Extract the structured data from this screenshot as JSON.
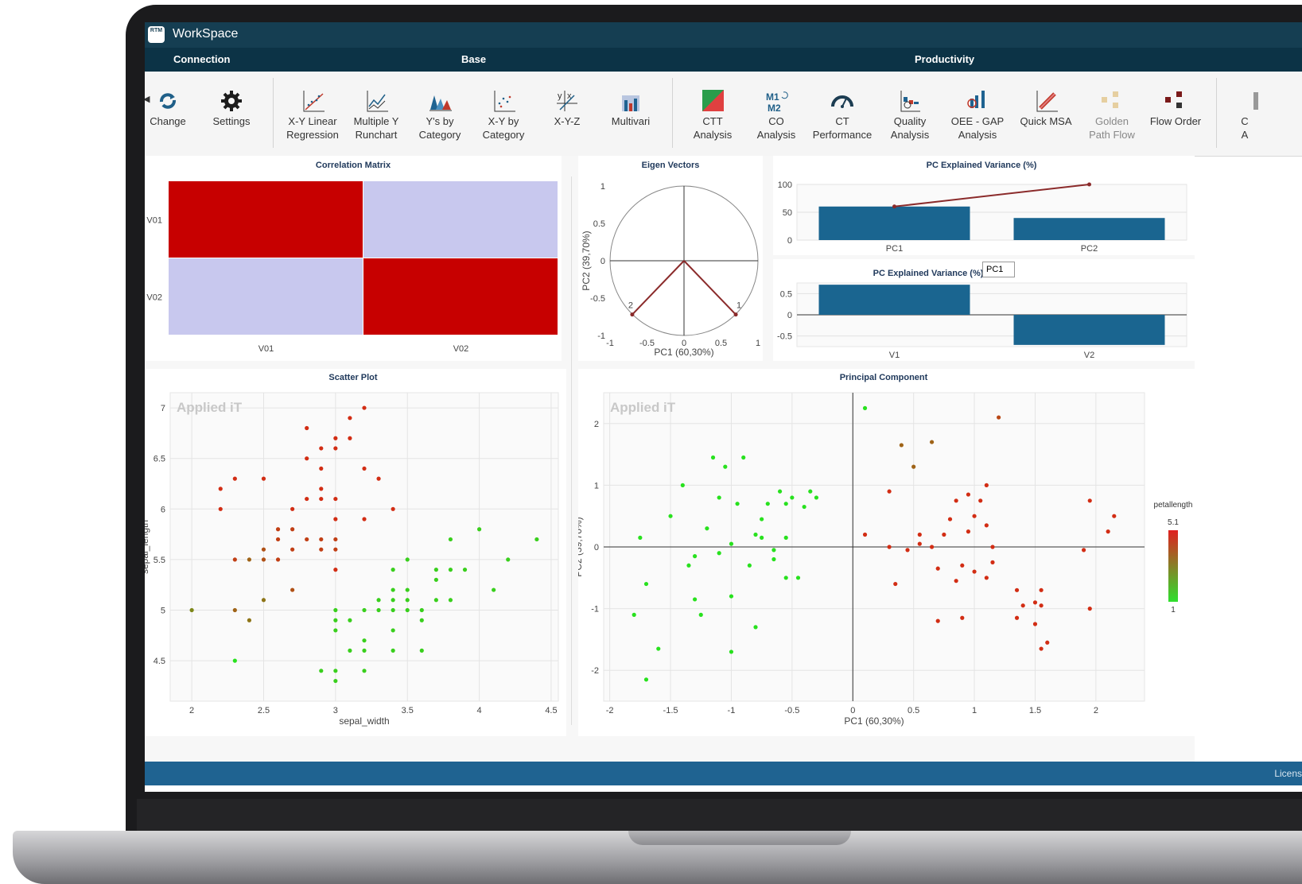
{
  "app": {
    "title": "WorkSpace",
    "logo_text": "RTM"
  },
  "groups": [
    "Connection",
    "Base",
    "Productivity"
  ],
  "toolbar": {
    "items": [
      {
        "label": "Change",
        "icon": "change-icon"
      },
      {
        "label": "Settings",
        "icon": "gear-icon"
      },
      {
        "label": "X-Y Linear\nRegression",
        "icon": "linear-regression-icon"
      },
      {
        "label": "Multiple Y\nRunchart",
        "icon": "runchart-icon"
      },
      {
        "label": "Y's by\nCategory",
        "icon": "ys-by-category-icon"
      },
      {
        "label": "X-Y by\nCategory",
        "icon": "xy-by-category-icon"
      },
      {
        "label": "X-Y-Z",
        "icon": "xyz-icon"
      },
      {
        "label": "Multivari",
        "icon": "multivari-icon"
      },
      {
        "label": "CTT\nAnalysis",
        "icon": "ctt-analysis-icon"
      },
      {
        "label": "CO\nAnalysis",
        "icon": "co-analysis-icon"
      },
      {
        "label": "CT\nPerformance",
        "icon": "gauge-icon"
      },
      {
        "label": "Quality\nAnalysis",
        "icon": "quality-analysis-icon"
      },
      {
        "label": "OEE - GAP\nAnalysis",
        "icon": "oee-gap-icon"
      },
      {
        "label": "Quick MSA",
        "icon": "quick-msa-icon"
      },
      {
        "label": "Golden\nPath Flow",
        "icon": "golden-path-icon"
      },
      {
        "label": "Flow Order",
        "icon": "flow-order-icon"
      },
      {
        "label": "C\nA",
        "icon": "truncated-icon"
      }
    ]
  },
  "status": {
    "text": "Licens"
  },
  "colors": {
    "titlebar": "#153e52",
    "ribbon_header": "#0c3346",
    "status": "#1f6391",
    "bar": "#1a6590",
    "arrow": "#8b2b2b"
  },
  "panels": {
    "correlation_title": "Correlation Matrix",
    "eigen_title": "Eigen Vectors",
    "variance_title": "PC Explained Variance (%)",
    "loadings_title": "PC Explained Variance (%)",
    "loadings_select": "PC1",
    "scatter_title": "Scatter Plot",
    "pc_title": "Principal Component",
    "watermark": "Applied iT"
  },
  "chart_data": [
    {
      "type": "heatmap",
      "title": "Correlation Matrix",
      "x": [
        "V01",
        "V02"
      ],
      "y": [
        "V01",
        "V02"
      ],
      "cells": [
        [
          "high",
          "low"
        ],
        [
          "low",
          "high"
        ]
      ],
      "colors": {
        "high": "#c70000",
        "low": "#c8c8ee"
      }
    },
    {
      "type": "scatter",
      "title": "Eigen Vectors",
      "xlabel": "PC1 (60,30%)",
      "ylabel": "PC2 (39,70%)",
      "xlim": [
        -1,
        1
      ],
      "ylim": [
        -1,
        1
      ],
      "xticks": [
        "-1",
        "-0.5",
        "0",
        "0.5",
        "1"
      ],
      "yticks": [
        "-1",
        "-0.5",
        "0",
        "0.5",
        "1"
      ],
      "vectors": [
        {
          "name": "1",
          "x": 0.7,
          "y": -0.72
        },
        {
          "name": "2",
          "x": -0.7,
          "y": -0.72
        }
      ]
    },
    {
      "type": "bar",
      "title": "PC Explained Variance (%)",
      "categories": [
        "PC1",
        "PC2"
      ],
      "values": [
        60.3,
        39.7
      ],
      "cumulative": [
        60.3,
        100
      ],
      "ylim": [
        0,
        100
      ],
      "yticks": [
        "0",
        "50",
        "100"
      ]
    },
    {
      "type": "bar",
      "title": "PC Explained Variance (%)",
      "categories": [
        "V1",
        "V2"
      ],
      "values": [
        0.71,
        -0.71
      ],
      "ylim": [
        -0.75,
        0.75
      ],
      "yticks": [
        "-0.5",
        "0",
        "0.5"
      ]
    },
    {
      "type": "scatter",
      "title": "Scatter Plot",
      "xlabel": "sepal_width",
      "ylabel": "sepal_length",
      "xlim": [
        1.85,
        4.55
      ],
      "ylim": [
        4.1,
        7.15
      ],
      "xticks": [
        "2",
        "2.5",
        "3",
        "3.5",
        "4",
        "4.5"
      ],
      "yticks": [
        "4.5",
        "5",
        "5.5",
        "6",
        "6.5",
        "7"
      ],
      "color_scale": {
        "name": "petallength",
        "min": "1",
        "max": "5.1"
      },
      "points": [
        [
          2.0,
          5.0,
          0.5
        ],
        [
          2.2,
          6.2,
          1
        ],
        [
          2.2,
          6.0,
          1
        ],
        [
          2.3,
          6.3,
          1
        ],
        [
          2.3,
          5.5,
          0.9
        ],
        [
          2.3,
          5.0,
          0.7
        ],
        [
          2.3,
          4.5,
          0
        ],
        [
          2.4,
          5.5,
          0.7
        ],
        [
          2.4,
          4.9,
          0.6
        ],
        [
          2.5,
          6.3,
          1
        ],
        [
          2.5,
          5.6,
          0.8
        ],
        [
          2.5,
          5.5,
          0.8
        ],
        [
          2.5,
          5.1,
          0.6
        ],
        [
          2.6,
          5.8,
          0.9
        ],
        [
          2.6,
          5.7,
          0.9
        ],
        [
          2.6,
          5.5,
          0.9
        ],
        [
          2.7,
          5.8,
          0.9
        ],
        [
          2.7,
          5.6,
          0.9
        ],
        [
          2.7,
          5.2,
          0.8
        ],
        [
          2.7,
          6.0,
          1
        ],
        [
          2.8,
          6.8,
          1
        ],
        [
          2.8,
          6.5,
          1
        ],
        [
          2.8,
          6.1,
          1
        ],
        [
          2.8,
          5.7,
          0.9
        ],
        [
          2.9,
          6.6,
          1
        ],
        [
          2.9,
          6.4,
          1
        ],
        [
          2.9,
          6.2,
          1
        ],
        [
          2.9,
          6.1,
          1
        ],
        [
          2.9,
          5.7,
          0.9
        ],
        [
          2.9,
          5.6,
          0.9
        ],
        [
          2.9,
          4.4,
          0.1
        ],
        [
          3.0,
          6.7,
          1
        ],
        [
          3.0,
          6.6,
          1
        ],
        [
          3.0,
          6.1,
          1
        ],
        [
          3.0,
          5.9,
          1
        ],
        [
          3.0,
          5.7,
          0.9
        ],
        [
          3.0,
          5.6,
          0.9
        ],
        [
          3.0,
          5.4,
          1
        ],
        [
          3.0,
          5.0,
          0.1
        ],
        [
          3.0,
          4.9,
          0.1
        ],
        [
          3.0,
          4.8,
          0.1
        ],
        [
          3.0,
          4.4,
          0.1
        ],
        [
          3.0,
          4.3,
          0.1
        ],
        [
          3.1,
          6.9,
          1
        ],
        [
          3.1,
          6.7,
          1
        ],
        [
          3.1,
          4.9,
          0.1
        ],
        [
          3.1,
          4.6,
          0.1
        ],
        [
          3.2,
          7.0,
          1
        ],
        [
          3.2,
          6.4,
          1
        ],
        [
          3.2,
          5.9,
          1
        ],
        [
          3.2,
          5.0,
          0.1
        ],
        [
          3.2,
          4.7,
          0.1
        ],
        [
          3.2,
          4.6,
          0.1
        ],
        [
          3.2,
          4.4,
          0.1
        ],
        [
          3.3,
          6.3,
          1
        ],
        [
          3.3,
          5.1,
          0.1
        ],
        [
          3.3,
          5.0,
          0.1
        ],
        [
          3.4,
          6.0,
          1
        ],
        [
          3.4,
          5.4,
          0.1
        ],
        [
          3.4,
          5.2,
          0.1
        ],
        [
          3.4,
          5.1,
          0.1
        ],
        [
          3.4,
          5.0,
          0.1
        ],
        [
          3.4,
          4.8,
          0.1
        ],
        [
          3.4,
          4.6,
          0.1
        ],
        [
          3.5,
          5.5,
          0.1
        ],
        [
          3.5,
          5.2,
          0.1
        ],
        [
          3.5,
          5.1,
          0.1
        ],
        [
          3.5,
          5.0,
          0.1
        ],
        [
          3.6,
          5.0,
          0.1
        ],
        [
          3.6,
          4.9,
          0.1
        ],
        [
          3.6,
          4.6,
          0.1
        ],
        [
          3.7,
          5.4,
          0.1
        ],
        [
          3.7,
          5.3,
          0.1
        ],
        [
          3.7,
          5.1,
          0.1
        ],
        [
          3.8,
          5.7,
          0.1
        ],
        [
          3.8,
          5.4,
          0.1
        ],
        [
          3.8,
          5.1,
          0.1
        ],
        [
          3.9,
          5.4,
          0.1
        ],
        [
          4.0,
          5.8,
          0.1
        ],
        [
          4.1,
          5.2,
          0.1
        ],
        [
          4.2,
          5.5,
          0.1
        ],
        [
          4.4,
          5.7,
          0.1
        ]
      ]
    },
    {
      "type": "scatter",
      "title": "Principal Component",
      "xlabel": "PC1 (60,30%)",
      "ylabel": "PC2 (39,70%)",
      "xlim": [
        -2.05,
        2.4
      ],
      "ylim": [
        -2.5,
        2.5
      ],
      "xticks": [
        "-2",
        "-1.5",
        "-1",
        "-0.5",
        "0",
        "0.5",
        "1",
        "1.5",
        "2"
      ],
      "yticks": [
        "-2",
        "-1",
        "0",
        "1",
        "2"
      ],
      "points": [
        [
          0.1,
          2.25,
          0
        ],
        [
          -1.7,
          -0.6,
          0
        ],
        [
          -1.6,
          -1.65,
          0
        ],
        [
          -1.5,
          0.5,
          0
        ],
        [
          -1.4,
          1.0,
          0
        ],
        [
          -1.3,
          -0.15,
          0
        ],
        [
          -1.3,
          -0.85,
          0
        ],
        [
          -1.2,
          0.3,
          0
        ],
        [
          -1.15,
          1.45,
          0
        ],
        [
          -1.1,
          0.8,
          0
        ],
        [
          -1.05,
          1.3,
          0
        ],
        [
          -1.0,
          0.05,
          0
        ],
        [
          -1.0,
          -0.8,
          0
        ],
        [
          -0.95,
          0.7,
          0
        ],
        [
          -0.9,
          1.45,
          0
        ],
        [
          -0.8,
          0.2,
          0
        ],
        [
          -0.75,
          0.15,
          0
        ],
        [
          -0.7,
          0.7,
          0
        ],
        [
          -0.65,
          -0.2,
          0
        ],
        [
          -0.6,
          0.9,
          0
        ],
        [
          -0.55,
          0.7,
          0
        ],
        [
          -0.55,
          -0.5,
          0
        ],
        [
          -0.5,
          0.8,
          0
        ],
        [
          -0.8,
          -1.3,
          0
        ],
        [
          -1.0,
          -1.7,
          0
        ],
        [
          -1.8,
          -1.1,
          0
        ],
        [
          -1.7,
          -2.15,
          0
        ],
        [
          -1.75,
          0.15,
          0
        ],
        [
          -1.35,
          -0.3,
          0
        ],
        [
          -1.25,
          -1.1,
          0
        ],
        [
          -1.1,
          -0.1,
          0
        ],
        [
          -0.85,
          -0.3,
          0
        ],
        [
          -0.75,
          0.45,
          0
        ],
        [
          -0.65,
          -0.05,
          0
        ],
        [
          -0.55,
          0.15,
          0
        ],
        [
          -0.45,
          -0.5,
          0
        ],
        [
          -0.4,
          0.65,
          0
        ],
        [
          -0.35,
          0.9,
          0
        ],
        [
          -0.3,
          0.8,
          0
        ],
        [
          0.4,
          1.65,
          0.7
        ],
        [
          0.5,
          1.3,
          0.7
        ],
        [
          0.65,
          1.7,
          0.7
        ],
        [
          0.3,
          0.9,
          1
        ],
        [
          0.1,
          0.2,
          1
        ],
        [
          0.3,
          0.0,
          1
        ],
        [
          0.35,
          -0.6,
          1
        ],
        [
          0.45,
          -0.05,
          1
        ],
        [
          0.55,
          0.05,
          1
        ],
        [
          0.55,
          0.2,
          1
        ],
        [
          0.65,
          0.0,
          1
        ],
        [
          0.7,
          -0.35,
          1
        ],
        [
          0.7,
          -1.2,
          1
        ],
        [
          0.75,
          0.2,
          1
        ],
        [
          0.8,
          0.45,
          1
        ],
        [
          0.85,
          0.75,
          1
        ],
        [
          0.85,
          -0.55,
          1
        ],
        [
          0.9,
          -1.15,
          1
        ],
        [
          0.9,
          -0.3,
          1
        ],
        [
          0.95,
          0.85,
          1
        ],
        [
          0.95,
          0.25,
          1
        ],
        [
          1.0,
          0.5,
          1
        ],
        [
          1.0,
          -0.4,
          1
        ],
        [
          1.05,
          0.75,
          1
        ],
        [
          1.1,
          1.0,
          1
        ],
        [
          1.1,
          0.35,
          1
        ],
        [
          1.1,
          -0.5,
          1
        ],
        [
          1.15,
          -0.25,
          1
        ],
        [
          1.15,
          0.0,
          1
        ],
        [
          1.2,
          2.1,
          0.85
        ],
        [
          1.35,
          -0.7,
          1
        ],
        [
          1.35,
          -1.15,
          1
        ],
        [
          1.4,
          -0.95,
          1
        ],
        [
          1.5,
          -0.9,
          1
        ],
        [
          1.5,
          -1.25,
          1
        ],
        [
          1.55,
          -1.65,
          1
        ],
        [
          1.55,
          -0.7,
          1
        ],
        [
          1.55,
          -0.95,
          1
        ],
        [
          1.6,
          -1.55,
          1
        ],
        [
          1.9,
          -0.05,
          1
        ],
        [
          1.95,
          -1.0,
          1
        ],
        [
          1.95,
          0.75,
          1
        ],
        [
          2.1,
          0.25,
          1
        ],
        [
          2.15,
          0.5,
          1
        ]
      ]
    }
  ]
}
